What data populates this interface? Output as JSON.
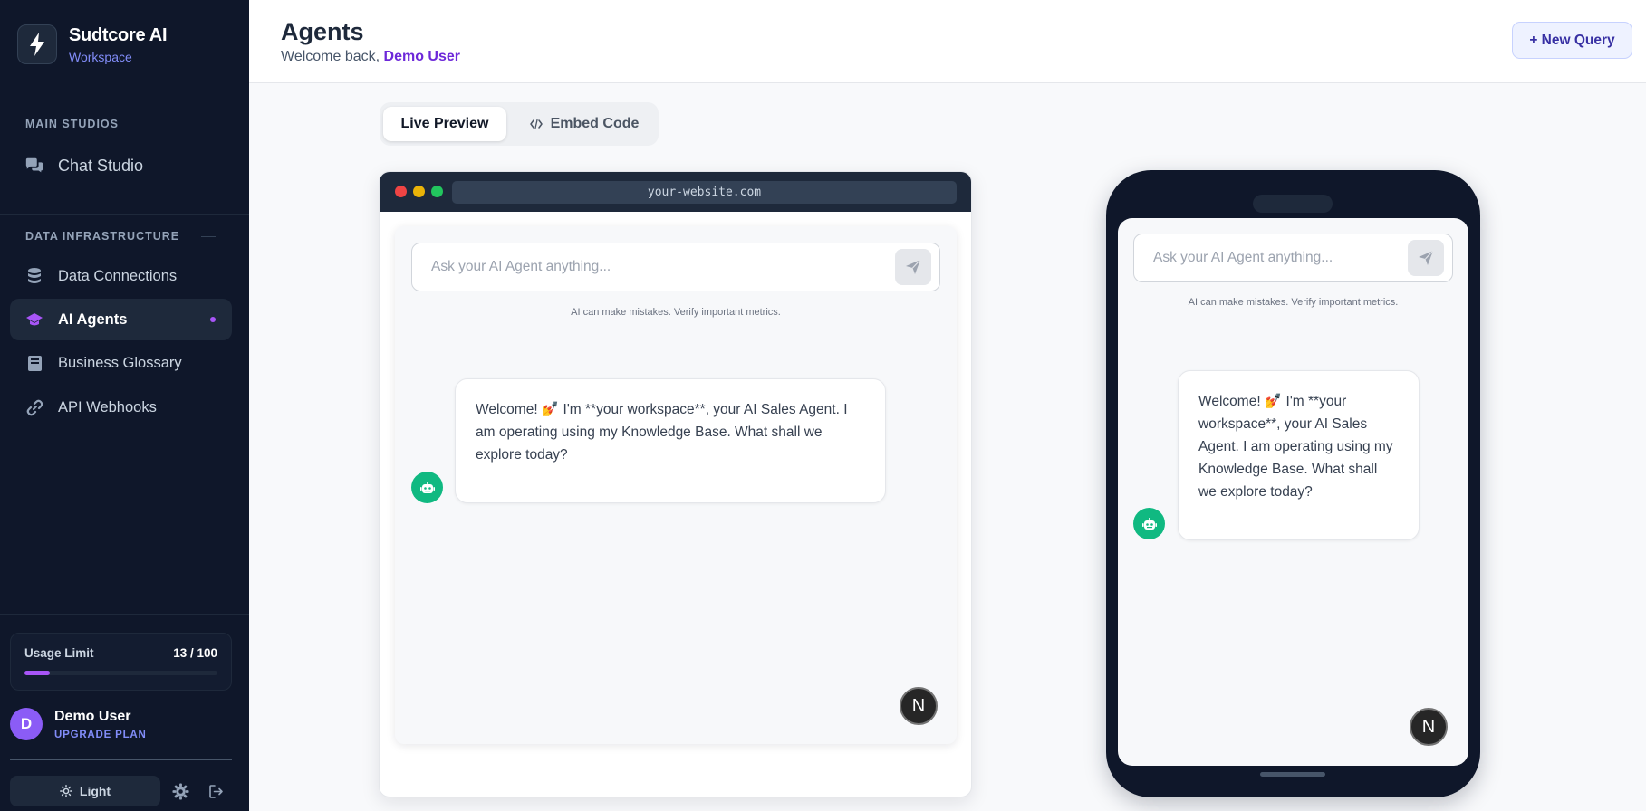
{
  "sidebar": {
    "brand_title": "Sudtcore AI",
    "brand_subtitle": "Workspace",
    "section_main": "MAIN STUDIOS",
    "chat_studio": "Chat Studio",
    "section_data": "DATA INFRASTRUCTURE",
    "items": [
      {
        "label": "Data Connections",
        "icon": "database-icon"
      },
      {
        "label": "AI Agents",
        "icon": "graduation-cap-icon",
        "active": true
      },
      {
        "label": "Business Glossary",
        "icon": "book-icon"
      },
      {
        "label": "API Webhooks",
        "icon": "link-icon"
      }
    ],
    "usage_label": "Usage Limit",
    "usage_count": "13 / 100",
    "usage_used": 13,
    "usage_total": 100,
    "user_initial": "D",
    "user_name": "Demo User",
    "user_plan": "UPGRADE PLAN",
    "theme_label": "Light"
  },
  "header": {
    "title": "Agents",
    "welcome_prefix": "Welcome back, ",
    "welcome_user": "Demo User",
    "new_query_label": "+ New Query"
  },
  "tabs": {
    "live_preview": "Live Preview",
    "embed_code": "Embed Code"
  },
  "preview": {
    "url": "your-website.com",
    "input_placeholder": "Ask your AI Agent anything...",
    "disclaimer": "AI can make mistakes. Verify important metrics.",
    "welcome_message": "Welcome! 💅 I'm **your workspace**, your AI Sales Agent. I am operating using my Knowledge Base. What shall we explore today?",
    "launcher_label": "N"
  },
  "colors": {
    "sidebar_bg": "#0f172a",
    "accent": "#a855f7",
    "brand_accent": "#818cf8",
    "bot_green": "#10b981"
  }
}
